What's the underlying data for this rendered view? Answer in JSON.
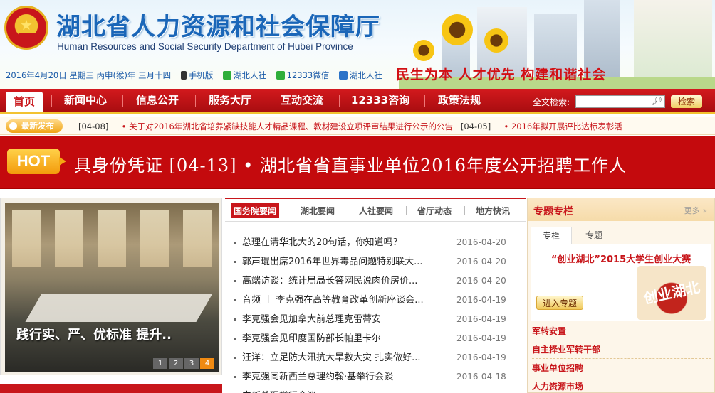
{
  "header": {
    "title_cn": "湖北省人力资源和社会保障厅",
    "title_en": "Human Resources and Social Security Department of Hubei Province",
    "date": "2016年4月20日 星期三 丙申(猴)年 三月十四",
    "links": [
      {
        "label": "手机版",
        "icon": "phone-icon"
      },
      {
        "label": "湖北人社",
        "icon": "wechat-icon"
      },
      {
        "label": "12333微信",
        "icon": "wechat-icon"
      },
      {
        "label": "湖北人社",
        "icon": "weibo-icon"
      }
    ],
    "slogan": "民生为本 人才优先 构建和谐社会"
  },
  "nav": {
    "items": [
      "首页",
      "新闻中心",
      "信息公开",
      "服务大厅",
      "互动交流",
      "12333咨询",
      "政策法规"
    ],
    "search_label": "全文检索:",
    "search_value": "",
    "search_button": "检索"
  },
  "ticker": {
    "badge": "最新发布",
    "date1": "[04-08]",
    "item": "• 关于对2016年湖北省培养紧缺技能人才精品课程、教材建设立项评审结果进行公示的公告",
    "date2": "[04-05]",
    "item2": "• 2016年拟开展评比达标表彰活"
  },
  "hot": {
    "badge": "HOT",
    "text": "具身份凭证 [04-13]   •  湖北省省直事业单位2016年度公开招聘工作人"
  },
  "photo": {
    "caption": "践行实、严、优标准 提升..",
    "pages": [
      "1",
      "2",
      "3",
      "4"
    ],
    "active_page": 4
  },
  "news": {
    "tabs": [
      "国务院要闻",
      "湖北要闻",
      "人社要闻",
      "省厅动态",
      "地方快讯"
    ],
    "items": [
      {
        "title": "总理在清华北大的20句话，你知道吗？",
        "date": "2016-04-20"
      },
      {
        "title": "郭声琨出席2016年世界毒品问题特别联大...",
        "date": "2016-04-20"
      },
      {
        "title": "高端访谈：统计局局长答网民说肉价房价...",
        "date": "2016-04-20"
      },
      {
        "title": "音频 丨 李克强在高等教育改革创新座谈会...",
        "date": "2016-04-19"
      },
      {
        "title": "李克强会见加拿大前总理克雷蒂安",
        "date": "2016-04-19"
      },
      {
        "title": "李克强会见印度国防部长帕里卡尔",
        "date": "2016-04-19"
      },
      {
        "title": "汪洋：立足防大汛抗大旱救大灾 扎实做好...",
        "date": "2016-04-19"
      },
      {
        "title": "李克强同新西兰总理约翰·基举行会谈",
        "date": "2016-04-18"
      },
      {
        "title": "中新总理举行会谈",
        "date": ""
      }
    ]
  },
  "topics": {
    "title": "专题专栏",
    "more": "更多",
    "tabs": [
      "专栏",
      "专题"
    ],
    "feature_title": "“创业湖北”2015大学生创业大赛",
    "feature_image_text": "创业湖北",
    "enter_button": "进入专题",
    "links": [
      "军转安置",
      "自主择业军转干部",
      "事业单位招聘",
      "人力资源市场"
    ]
  },
  "colors": {
    "brand_red": "#c8161b",
    "title_blue": "#1a66b8",
    "accent_gold": "#f2c230"
  }
}
